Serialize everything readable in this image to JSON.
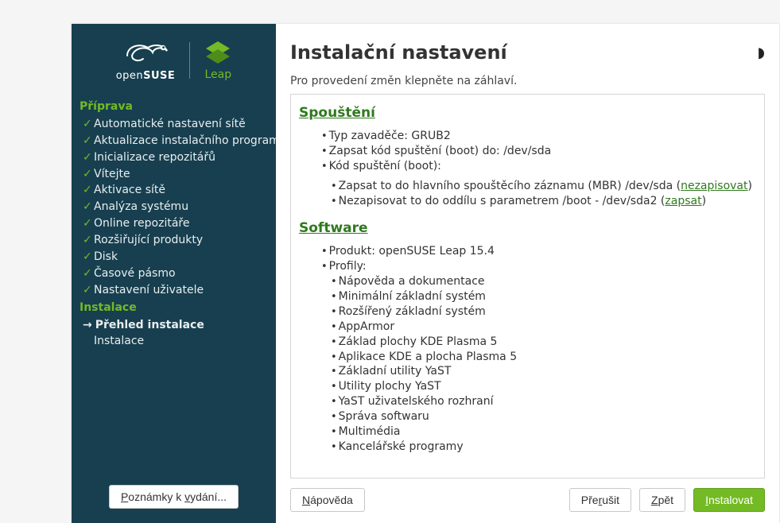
{
  "branding": {
    "distro": "openSUSE",
    "edition": "Leap"
  },
  "sidebar": {
    "section_prepare": "Příprava",
    "items_prepare": [
      "Automatické nastavení sítě",
      "Aktualizace instalačního programu",
      "Inicializace repozitářů",
      "Vítejte",
      "Aktivace sítě",
      "Analýza systému",
      "Online repozitáře",
      "Rozšiřující produkty",
      "Disk",
      "Časové pásmo",
      "Nastavení uživatele"
    ],
    "section_install": "Instalace",
    "current": "Přehled instalace",
    "pending": "Instalace",
    "release_notes": "Poznámky k vydání..."
  },
  "main": {
    "title": "Instalační nastavení",
    "instruction": "Pro provedení změn klepněte na záhlaví.",
    "boot": {
      "heading": "Spouštění",
      "bootloader_type": "Typ zavaděče: GRUB2",
      "write_to": "Zapsat kód spuštění (boot) do: /dev/sda",
      "boot_code": "Kód spuštění (boot):",
      "mbr_line_a": "Zapsat to do hlavního spouštěcího záznamu (MBR) /dev/sda (",
      "mbr_link": "nezapisovat",
      "mbr_line_b": ")",
      "part_line_a": "Nezapisovat to do oddílu s parametrem /boot - /dev/sda2 (",
      "part_link": "zapsat",
      "part_line_b": ")"
    },
    "software": {
      "heading": "Software",
      "product": "Produkt: openSUSE Leap 15.4",
      "profiles_label": "Profily:",
      "profiles": [
        "Nápověda a dokumentace",
        "Minimální základní systém",
        "Rozšířený základní systém",
        "AppArmor",
        "Základ plochy KDE Plasma 5",
        "Aplikace KDE a plocha Plasma 5",
        "Základní utility YaST",
        "Utility plochy YaST",
        "YaST uživatelského rozhraní",
        "Správa softwaru",
        "Multimédia",
        "Kancelářské programy"
      ]
    }
  },
  "buttons": {
    "help": "Nápověda",
    "abort": "Přerušit",
    "back": "Zpět",
    "install": "Instalovat"
  }
}
